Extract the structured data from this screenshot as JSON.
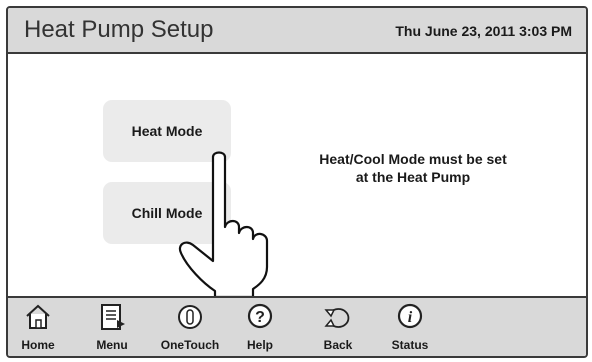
{
  "header": {
    "title": "Heat Pump Setup",
    "datetime": "Thu June 23, 2011  3:03 PM"
  },
  "main": {
    "heat_mode_label": "Heat Mode",
    "chill_mode_label": "Chill Mode",
    "message_line1": "Heat/Cool Mode must be set",
    "message_line2": "at the Heat Pump"
  },
  "footer": {
    "items": [
      {
        "label": "Home",
        "icon": "home-icon"
      },
      {
        "label": "Menu",
        "icon": "menu-icon"
      },
      {
        "label": "OneTouch",
        "icon": "onetouch-icon"
      },
      {
        "label": "Help",
        "icon": "help-icon"
      },
      {
        "label": "Back",
        "icon": "back-icon"
      },
      {
        "label": "Status",
        "icon": "status-icon"
      }
    ]
  },
  "colors": {
    "header_bg": "#d9d9d9",
    "button_bg": "#ebebeb",
    "border": "#3a3a3a"
  }
}
